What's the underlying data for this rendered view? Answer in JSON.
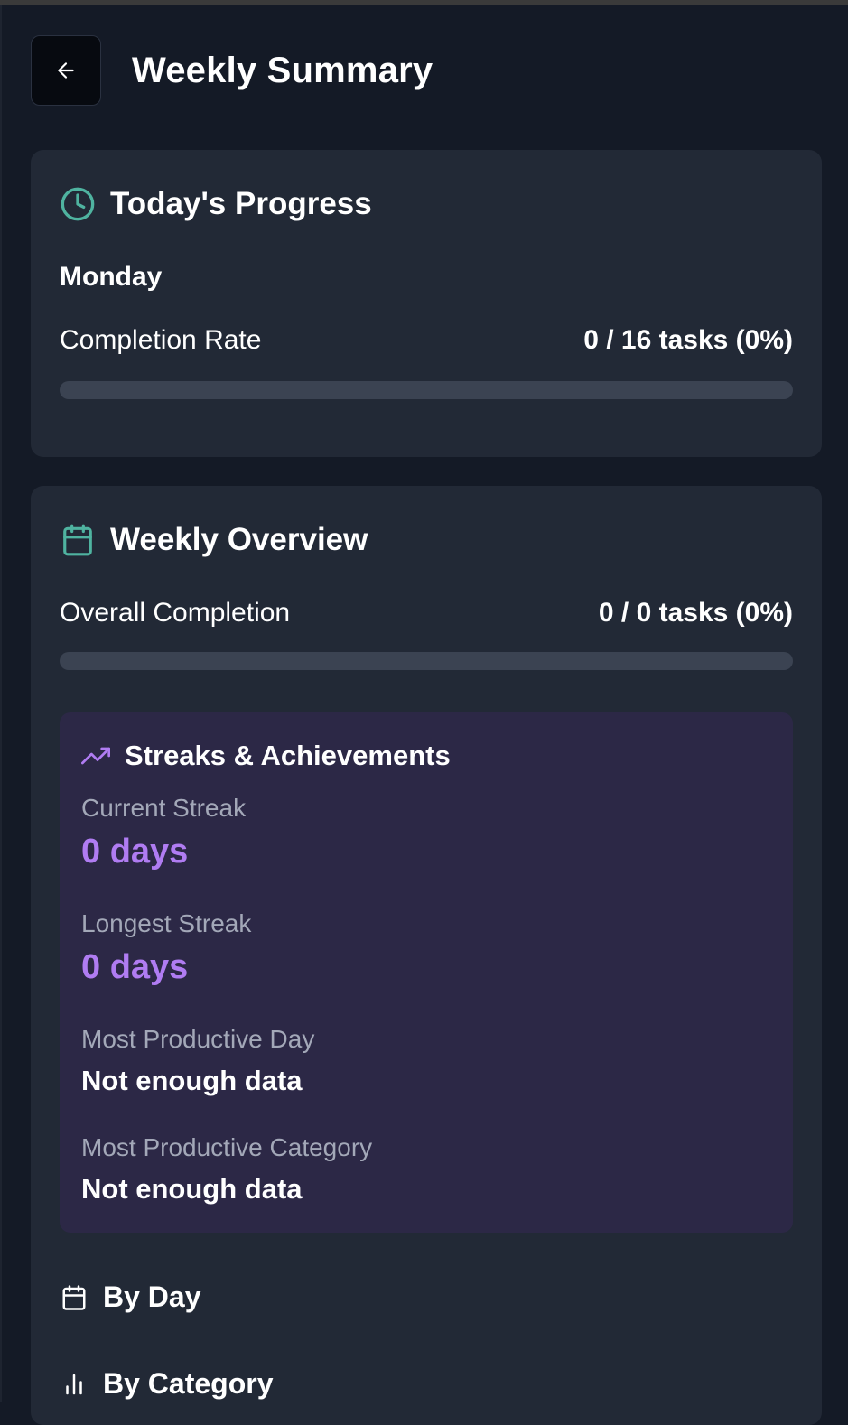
{
  "header": {
    "title": "Weekly Summary",
    "back_icon": "arrow-left-icon"
  },
  "today": {
    "title": "Today's Progress",
    "icon": "clock-icon",
    "day": "Monday",
    "completion_label": "Completion Rate",
    "completion_value": "0 / 16 tasks (0%)",
    "progress_fraction": 0
  },
  "weekly": {
    "title": "Weekly Overview",
    "icon": "calendar-icon",
    "overall_label": "Overall Completion",
    "overall_value": "0 / 0 tasks (0%)",
    "progress_fraction": 0,
    "streaks": {
      "title": "Streaks & Achievements",
      "icon": "trending-up-icon",
      "current_label": "Current Streak",
      "current_value": "0 days",
      "longest_label": "Longest Streak",
      "longest_value": "0 days",
      "productive_day_label": "Most Productive Day",
      "productive_day_value": "Not enough data",
      "productive_category_label": "Most Productive Category",
      "productive_category_value": "Not enough data"
    },
    "sections": {
      "by_day": "By Day",
      "by_category": "By Category"
    }
  },
  "colors": {
    "background": "#141a26",
    "card": "#222936",
    "accent_teal": "#4fb3a0",
    "accent_purple": "#b07cf2",
    "streak_panel": "#2c2846",
    "progress_track": "#3b4352"
  }
}
